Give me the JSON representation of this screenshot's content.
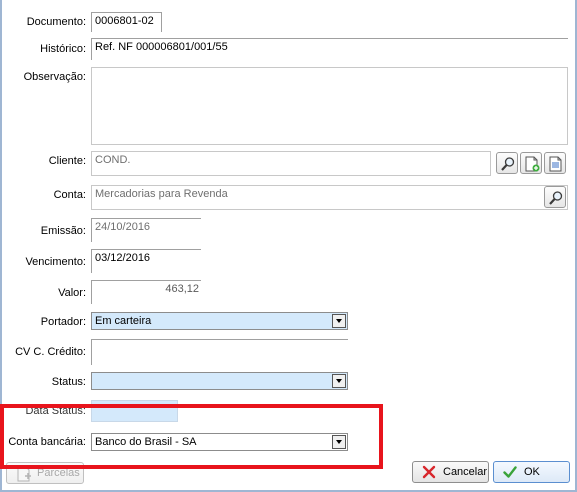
{
  "form": {
    "documento": {
      "label": "Documento:",
      "value": "0006801-02"
    },
    "historico": {
      "label": "Histórico:",
      "value": "Ref. NF 000006801/001/55"
    },
    "observacao": {
      "label": "Observação:",
      "value": ""
    },
    "cliente": {
      "label": "Cliente:",
      "value": "COND."
    },
    "conta": {
      "label": "Conta:",
      "value": "Mercadorias para Revenda"
    },
    "emissao": {
      "label": "Emissão:",
      "value": "24/10/2016"
    },
    "vencimento": {
      "label": "Vencimento:",
      "value": "03/12/2016"
    },
    "valor": {
      "label": "Valor:",
      "value": "463,12"
    },
    "portador": {
      "label": "Portador:",
      "value": "Em carteira"
    },
    "cv_credito": {
      "label": "CV C. Crédito:",
      "value": ""
    },
    "status": {
      "label": "Status:",
      "value": ""
    },
    "data_status": {
      "label": "Data Status:",
      "value": ""
    },
    "conta_bancaria": {
      "label": "Conta bancária:",
      "value": "Banco do Brasil - SA"
    }
  },
  "buttons": {
    "parcelas": "Parcelas",
    "cancelar": "Cancelar",
    "ok": "OK"
  },
  "icons": {
    "cliente_search": "magnifier-icon",
    "cliente_new": "new-document-icon",
    "cliente_edit": "document-icon",
    "conta_search": "magnifier-icon"
  },
  "colors": {
    "highlight_box": "#e8141c",
    "field_selected": "#d4e9fb"
  }
}
